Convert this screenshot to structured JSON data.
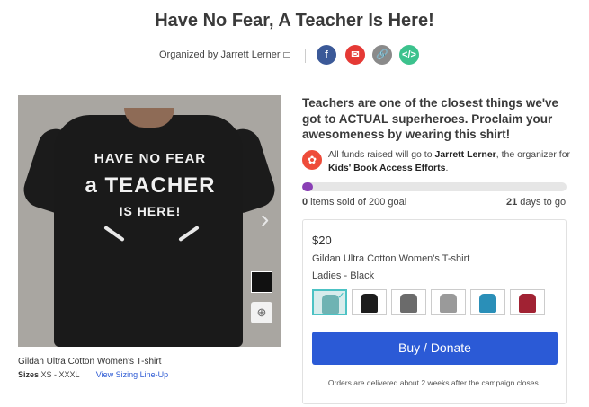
{
  "header": {
    "title": "Have No Fear, A Teacher Is Here!",
    "organized_by": "Organized by Jarrett Lerner"
  },
  "share": {
    "facebook_label": "f",
    "email_label": "✉",
    "link_label": "🔗",
    "embed_label": "</>"
  },
  "shirt": {
    "line1": "HAVE NO FEAR",
    "line2": "a TEACHER",
    "line3": "IS HERE!"
  },
  "product": {
    "name": "Gildan Ultra Cotton Women's T-shirt",
    "sizes_label": "Sizes",
    "sizes_value": "XS - XXXL",
    "sizing_link": "View Sizing Line-Up"
  },
  "campaign": {
    "tagline": "Teachers are one of the closest things we've got to ACTUAL superheroes. Proclaim your awesomeness by wearing this shirt!",
    "funds_prefix": "All funds raised will go to ",
    "funds_recipient": "Jarrett Lerner",
    "funds_mid": ", the organizer for ",
    "funds_cause": "Kids' Book Access Efforts",
    "funds_suffix": ".",
    "progress": 0.04,
    "sold_count": "0",
    "sold_text": " items sold of 200 goal",
    "days_count": "21",
    "days_text": " days to go"
  },
  "card": {
    "price": "$20",
    "product": "Gildan Ultra Cotton Women's T-shirt",
    "variant": "Ladies - Black",
    "swatch_colors": [
      "#6fb3b3",
      "#1c1c1c",
      "#6b6b6b",
      "#9a9a9a",
      "#2a8fb8",
      "#a12233"
    ],
    "buy_label": "Buy / Donate",
    "orders_note": "Orders are delivered about 2 weeks after the campaign closes."
  },
  "colors": {
    "buy_button": "#2b5ad6",
    "progress": "#8a3fb5",
    "selected": "#4cc2c4"
  }
}
